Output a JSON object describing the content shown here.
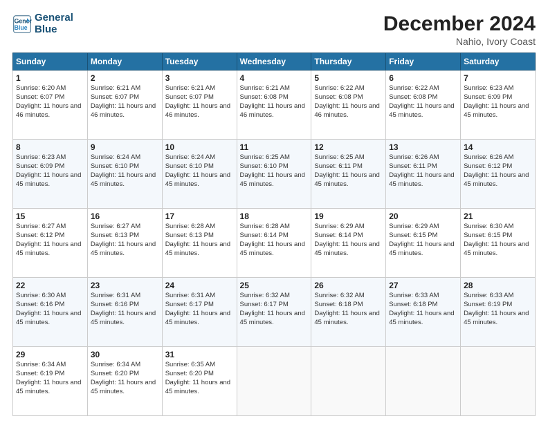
{
  "header": {
    "logo_line1": "General",
    "logo_line2": "Blue",
    "title": "December 2024",
    "subtitle": "Nahio, Ivory Coast"
  },
  "days_of_week": [
    "Sunday",
    "Monday",
    "Tuesday",
    "Wednesday",
    "Thursday",
    "Friday",
    "Saturday"
  ],
  "weeks": [
    [
      {
        "day": "1",
        "sunrise": "6:20 AM",
        "sunset": "6:07 PM",
        "daylight": "11 hours and 46 minutes."
      },
      {
        "day": "2",
        "sunrise": "6:21 AM",
        "sunset": "6:07 PM",
        "daylight": "11 hours and 46 minutes."
      },
      {
        "day": "3",
        "sunrise": "6:21 AM",
        "sunset": "6:07 PM",
        "daylight": "11 hours and 46 minutes."
      },
      {
        "day": "4",
        "sunrise": "6:21 AM",
        "sunset": "6:08 PM",
        "daylight": "11 hours and 46 minutes."
      },
      {
        "day": "5",
        "sunrise": "6:22 AM",
        "sunset": "6:08 PM",
        "daylight": "11 hours and 46 minutes."
      },
      {
        "day": "6",
        "sunrise": "6:22 AM",
        "sunset": "6:08 PM",
        "daylight": "11 hours and 45 minutes."
      },
      {
        "day": "7",
        "sunrise": "6:23 AM",
        "sunset": "6:09 PM",
        "daylight": "11 hours and 45 minutes."
      }
    ],
    [
      {
        "day": "8",
        "sunrise": "6:23 AM",
        "sunset": "6:09 PM",
        "daylight": "11 hours and 45 minutes."
      },
      {
        "day": "9",
        "sunrise": "6:24 AM",
        "sunset": "6:10 PM",
        "daylight": "11 hours and 45 minutes."
      },
      {
        "day": "10",
        "sunrise": "6:24 AM",
        "sunset": "6:10 PM",
        "daylight": "11 hours and 45 minutes."
      },
      {
        "day": "11",
        "sunrise": "6:25 AM",
        "sunset": "6:10 PM",
        "daylight": "11 hours and 45 minutes."
      },
      {
        "day": "12",
        "sunrise": "6:25 AM",
        "sunset": "6:11 PM",
        "daylight": "11 hours and 45 minutes."
      },
      {
        "day": "13",
        "sunrise": "6:26 AM",
        "sunset": "6:11 PM",
        "daylight": "11 hours and 45 minutes."
      },
      {
        "day": "14",
        "sunrise": "6:26 AM",
        "sunset": "6:12 PM",
        "daylight": "11 hours and 45 minutes."
      }
    ],
    [
      {
        "day": "15",
        "sunrise": "6:27 AM",
        "sunset": "6:12 PM",
        "daylight": "11 hours and 45 minutes."
      },
      {
        "day": "16",
        "sunrise": "6:27 AM",
        "sunset": "6:13 PM",
        "daylight": "11 hours and 45 minutes."
      },
      {
        "day": "17",
        "sunrise": "6:28 AM",
        "sunset": "6:13 PM",
        "daylight": "11 hours and 45 minutes."
      },
      {
        "day": "18",
        "sunrise": "6:28 AM",
        "sunset": "6:14 PM",
        "daylight": "11 hours and 45 minutes."
      },
      {
        "day": "19",
        "sunrise": "6:29 AM",
        "sunset": "6:14 PM",
        "daylight": "11 hours and 45 minutes."
      },
      {
        "day": "20",
        "sunrise": "6:29 AM",
        "sunset": "6:15 PM",
        "daylight": "11 hours and 45 minutes."
      },
      {
        "day": "21",
        "sunrise": "6:30 AM",
        "sunset": "6:15 PM",
        "daylight": "11 hours and 45 minutes."
      }
    ],
    [
      {
        "day": "22",
        "sunrise": "6:30 AM",
        "sunset": "6:16 PM",
        "daylight": "11 hours and 45 minutes."
      },
      {
        "day": "23",
        "sunrise": "6:31 AM",
        "sunset": "6:16 PM",
        "daylight": "11 hours and 45 minutes."
      },
      {
        "day": "24",
        "sunrise": "6:31 AM",
        "sunset": "6:17 PM",
        "daylight": "11 hours and 45 minutes."
      },
      {
        "day": "25",
        "sunrise": "6:32 AM",
        "sunset": "6:17 PM",
        "daylight": "11 hours and 45 minutes."
      },
      {
        "day": "26",
        "sunrise": "6:32 AM",
        "sunset": "6:18 PM",
        "daylight": "11 hours and 45 minutes."
      },
      {
        "day": "27",
        "sunrise": "6:33 AM",
        "sunset": "6:18 PM",
        "daylight": "11 hours and 45 minutes."
      },
      {
        "day": "28",
        "sunrise": "6:33 AM",
        "sunset": "6:19 PM",
        "daylight": "11 hours and 45 minutes."
      }
    ],
    [
      {
        "day": "29",
        "sunrise": "6:34 AM",
        "sunset": "6:19 PM",
        "daylight": "11 hours and 45 minutes."
      },
      {
        "day": "30",
        "sunrise": "6:34 AM",
        "sunset": "6:20 PM",
        "daylight": "11 hours and 45 minutes."
      },
      {
        "day": "31",
        "sunrise": "6:35 AM",
        "sunset": "6:20 PM",
        "daylight": "11 hours and 45 minutes."
      },
      null,
      null,
      null,
      null
    ]
  ]
}
